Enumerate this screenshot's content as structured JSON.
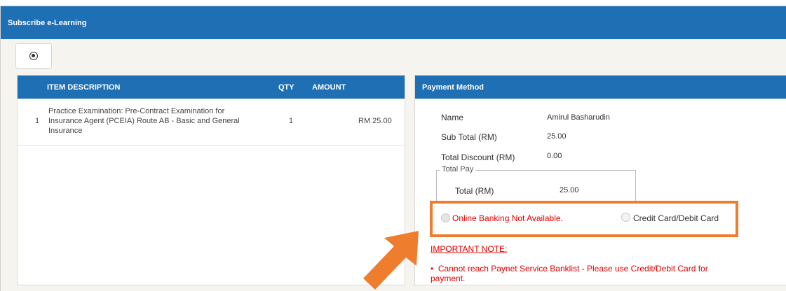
{
  "window": {
    "title": "Subscribe e-Learning"
  },
  "toolbar": {
    "back_icon": "circle-arrow-back-icon"
  },
  "items_table": {
    "headers": {
      "description": "ITEM DESCRIPTION",
      "qty": "QTY",
      "amount": "AMOUNT"
    },
    "rows": [
      {
        "no": "1",
        "description": "Practice Examination: Pre-Contract Examination for Insurance Agent (PCEIA) Route AB - Basic and General Insurance",
        "qty": "1",
        "amount": "RM 25.00"
      }
    ]
  },
  "payment": {
    "title": "Payment Method",
    "name_label": "Name",
    "name_value": "Amirul Basharudin",
    "subtotal_label": "Sub Total (RM)",
    "subtotal_value": "25.00",
    "discount_label": "Total Discount (RM)",
    "discount_value": "0.00",
    "totalpay_legend": "Total Pay",
    "total_label": "Total (RM)",
    "total_value": "25.00",
    "online_banking_label": "Online Banking Not Available.",
    "card_label": "Credit Card/Debit Card",
    "note_title": "IMPORTANT NOTE:",
    "note_text": "Cannot reach Paynet Service Banklist - Please use Credit/Debit Card for payment."
  },
  "colors": {
    "header_blue": "#1f6fb5",
    "highlight_orange": "#ee7d2e",
    "warning_red": "#e00000"
  }
}
